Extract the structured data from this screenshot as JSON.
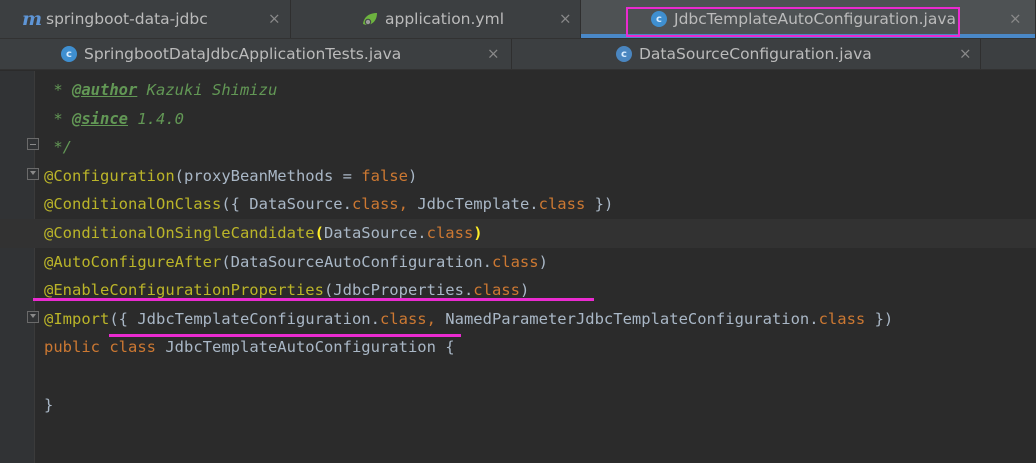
{
  "tabs_row1": [
    {
      "icon": "maven-module-icon",
      "label": "springboot-data-jdbc",
      "active": false,
      "close": "×"
    },
    {
      "icon": "spring-yaml-icon",
      "label": "application.yml",
      "active": false,
      "close": "×"
    },
    {
      "icon": "java-class-icon",
      "label": "JdbcTemplateAutoConfiguration.java",
      "active": true,
      "close": "×"
    }
  ],
  "tabs_row2": [
    {
      "icon": "java-test-class-icon",
      "label": "SpringbootDataJdbcApplicationTests.java",
      "close": "×"
    },
    {
      "icon": "java-class-icon",
      "label": "DataSourceConfiguration.java",
      "close": "×"
    }
  ],
  "icons": {
    "mvn_letter": "m",
    "class_letter": "c"
  },
  "code_lines": [
    [
      {
        "t": " * ",
        "c": "doc"
      },
      {
        "t": "@author",
        "c": "doctag"
      },
      {
        "t": " Kazuki Shimizu",
        "c": "doc"
      }
    ],
    [
      {
        "t": " * ",
        "c": "doc"
      },
      {
        "t": "@since",
        "c": "doctag"
      },
      {
        "t": " 1.4.0",
        "c": "doc"
      }
    ],
    [
      {
        "t": " */",
        "c": "doc"
      }
    ],
    [
      {
        "t": "@Configuration",
        "c": "ann"
      },
      {
        "t": "(proxyBeanMethods = ",
        "c": "plain"
      },
      {
        "t": "false",
        "c": "kw"
      },
      {
        "t": ")",
        "c": "plain"
      }
    ],
    [
      {
        "t": "@ConditionalOnClass",
        "c": "ann"
      },
      {
        "t": "({ DataSource.",
        "c": "plain"
      },
      {
        "t": "class",
        "c": "kw"
      },
      {
        "t": ", ",
        "c": "kw"
      },
      {
        "t": "JdbcTemplate.",
        "c": "plain"
      },
      {
        "t": "class",
        "c": "kw"
      },
      {
        "t": " })",
        "c": "plain"
      }
    ],
    [
      {
        "t": "@ConditionalOnSingleCandidate",
        "c": "ann"
      },
      {
        "t": "(",
        "c": "brace"
      },
      {
        "t": "DataSource.",
        "c": "plain"
      },
      {
        "t": "class",
        "c": "kw"
      },
      {
        "t": ")",
        "c": "brace"
      }
    ],
    [
      {
        "t": "@AutoConfigureAfter",
        "c": "ann"
      },
      {
        "t": "(DataSourceAutoConfiguration.",
        "c": "plain"
      },
      {
        "t": "class",
        "c": "kw"
      },
      {
        "t": ")",
        "c": "plain"
      }
    ],
    [
      {
        "t": "@EnableConfigurationProperties",
        "c": "ann"
      },
      {
        "t": "(JdbcProperties.",
        "c": "plain"
      },
      {
        "t": "class",
        "c": "kw"
      },
      {
        "t": ")",
        "c": "plain"
      }
    ],
    [
      {
        "t": "@Import",
        "c": "ann"
      },
      {
        "t": "({ JdbcTemplateConfiguration.",
        "c": "plain"
      },
      {
        "t": "class",
        "c": "kw"
      },
      {
        "t": ", ",
        "c": "kw"
      },
      {
        "t": "NamedParameterJdbcTemplateConfiguration.",
        "c": "plain"
      },
      {
        "t": "class",
        "c": "kw"
      },
      {
        "t": " })",
        "c": "plain"
      }
    ],
    [
      {
        "t": "public ",
        "c": "kw"
      },
      {
        "t": "class ",
        "c": "kw"
      },
      {
        "t": "JdbcTemplateAutoConfiguration {",
        "c": "plain"
      }
    ],
    [],
    [
      {
        "t": "}",
        "c": "plain"
      }
    ]
  ],
  "current_line": 5,
  "colors": {
    "annotation": "#bbb529",
    "keyword": "#cc7832",
    "highlight": "#ea2bd0",
    "active_tab_underline": "#4a88c7"
  }
}
